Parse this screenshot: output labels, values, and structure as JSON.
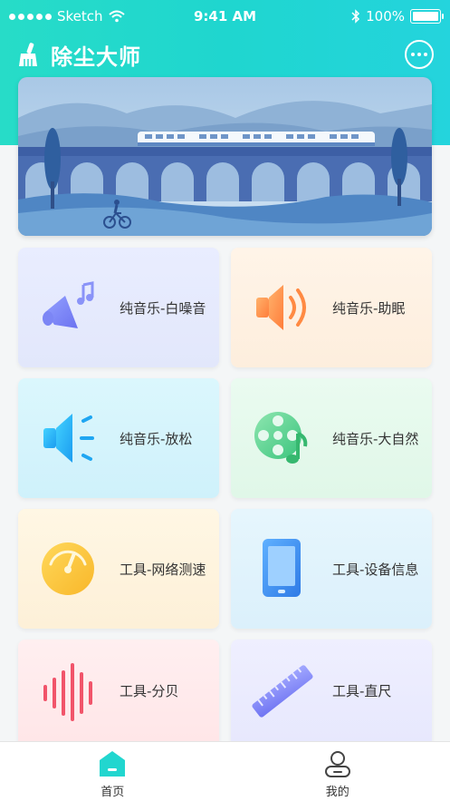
{
  "status_bar": {
    "carrier": "Sketch",
    "time": "9:41 AM",
    "battery": "100%"
  },
  "header": {
    "title": "除尘大师"
  },
  "cards": [
    {
      "label": "纯音乐-白噪音",
      "icon": "megaphone-music-icon"
    },
    {
      "label": "纯音乐-助眠",
      "icon": "speaker-sound-icon"
    },
    {
      "label": "纯音乐-放松",
      "icon": "speaker-wave-icon"
    },
    {
      "label": "纯音乐-大自然",
      "icon": "film-reel-music-icon"
    },
    {
      "label": "工具-网络测速",
      "icon": "speedometer-icon"
    },
    {
      "label": "工具-设备信息",
      "icon": "phone-device-icon"
    },
    {
      "label": "工具-分贝",
      "icon": "sound-bars-icon"
    },
    {
      "label": "工具-直尺",
      "icon": "ruler-icon"
    }
  ],
  "tabbar": {
    "home_label": "首页",
    "mine_label": "我的",
    "active": "home"
  },
  "colors": {
    "accent": "#22d6cf",
    "card_bg": [
      "#e8ecff",
      "#fff2e6",
      "#d9f6fc",
      "#e8fbef",
      "#fff6e2",
      "#e3f5fd",
      "#ffecee",
      "#ececff"
    ]
  }
}
